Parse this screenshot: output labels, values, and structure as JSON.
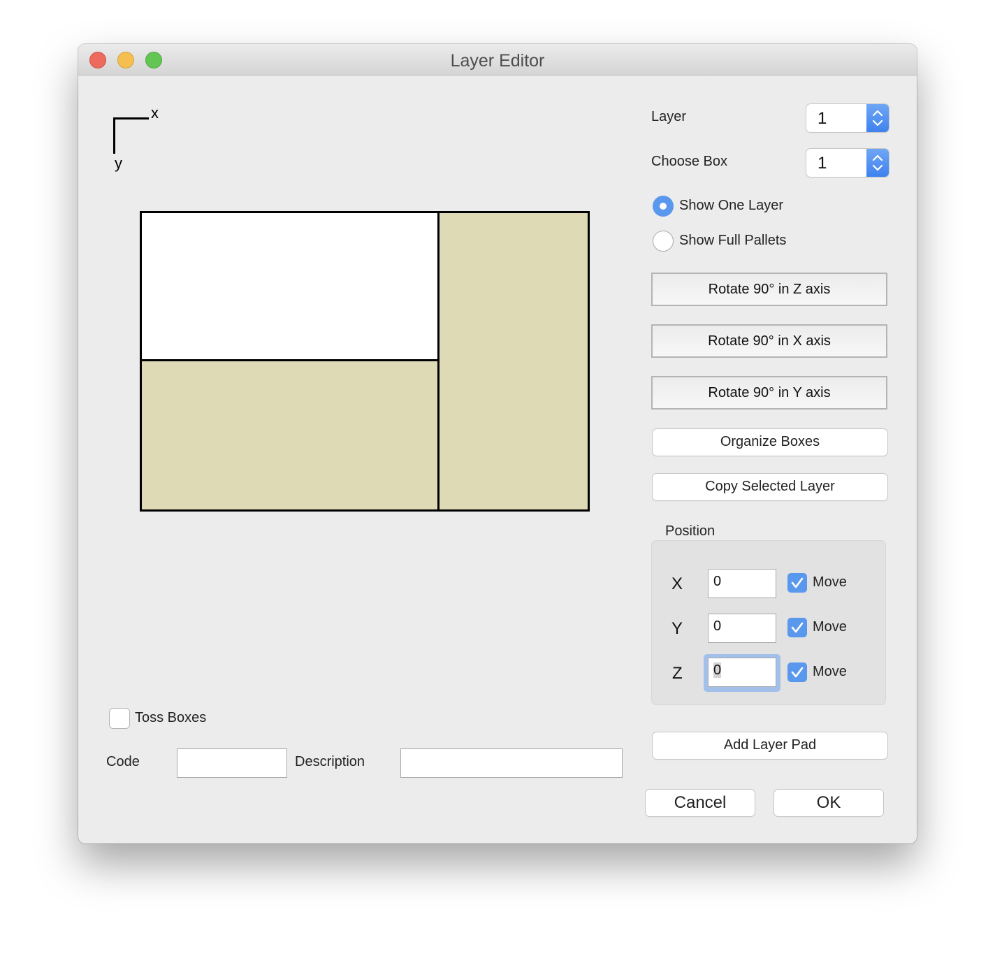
{
  "window": {
    "title": "Layer Editor",
    "controls": [
      "close",
      "minimize",
      "maximize"
    ]
  },
  "axis_indicator": {
    "x_label": "x",
    "y_label": "y"
  },
  "layer_view": {
    "boxes": [
      {
        "name": "box-1",
        "fill": "#ffffff",
        "col": 0,
        "row": 0
      },
      {
        "name": "box-2",
        "fill": "#dedab5",
        "col": 0,
        "row": 1
      },
      {
        "name": "box-3",
        "fill": "#dedab5",
        "col": 1,
        "row": 0
      }
    ],
    "border_color": "#000000"
  },
  "right_panel": {
    "layer": {
      "label": "Layer",
      "value": "1"
    },
    "choose_box": {
      "label": "Choose Box",
      "value": "1"
    },
    "view_mode": {
      "options": [
        {
          "label": "Show One Layer",
          "selected": true
        },
        {
          "label": "Show Full Pallets",
          "selected": false
        }
      ]
    },
    "buttons": {
      "rotate_z": "Rotate 90° in Z axis",
      "rotate_x": "Rotate 90° in X axis",
      "rotate_y": "Rotate 90° in Y axis",
      "organize": "Organize Boxes",
      "copy_layer": "Copy Selected Layer",
      "add_layer_pad": "Add Layer Pad",
      "cancel": "Cancel",
      "ok": "OK"
    },
    "position": {
      "title": "Position",
      "rows": [
        {
          "axis": "X",
          "value": "0",
          "move_label": "Move",
          "move_checked": true,
          "focused": false
        },
        {
          "axis": "Y",
          "value": "0",
          "move_label": "Move",
          "move_checked": true,
          "focused": false
        },
        {
          "axis": "Z",
          "value": "0",
          "move_label": "Move",
          "move_checked": true,
          "focused": true
        }
      ]
    }
  },
  "bottom": {
    "toss_boxes": {
      "label": "Toss Boxes",
      "checked": false
    },
    "code": {
      "label": "Code",
      "value": ""
    },
    "description": {
      "label": "Description",
      "value": ""
    }
  },
  "colors": {
    "accent": "#5a98ee",
    "box_fill": "#dedab5",
    "window_bg": "#ececec"
  }
}
